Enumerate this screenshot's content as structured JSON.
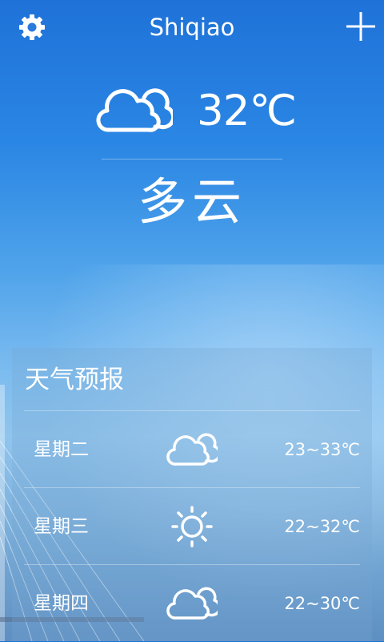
{
  "header": {
    "city": "Shiqiao",
    "settings_icon": "gear-icon",
    "add_icon": "plus-icon"
  },
  "current": {
    "icon": "cloudy-icon",
    "temperature": "32℃",
    "condition": "多云"
  },
  "forecast": {
    "title": "天气预报",
    "days": [
      {
        "day": "星期二",
        "icon": "cloudy-icon",
        "range": "23~33℃"
      },
      {
        "day": "星期三",
        "icon": "sun-icon",
        "range": "22~32℃"
      },
      {
        "day": "星期四",
        "icon": "cloudy-icon",
        "range": "22~30℃"
      }
    ]
  },
  "colors": {
    "sky_top": "#1f72d8",
    "sky_mid": "#7cbcef",
    "text": "#ffffff"
  }
}
